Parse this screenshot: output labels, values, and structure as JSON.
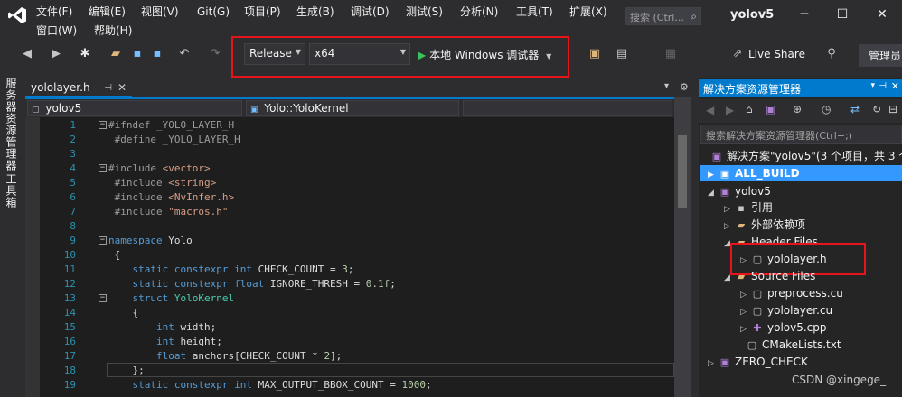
{
  "menu": {
    "row1": [
      "文件(F)",
      "编辑(E)",
      "视图(V)",
      "Git(G)",
      "项目(P)",
      "生成(B)",
      "调试(D)",
      "测试(S)",
      "分析(N)",
      "工具(T)",
      "扩展(X)"
    ],
    "row2": [
      "窗口(W)",
      "帮助(H)"
    ],
    "search_placeholder": "搜索 (Ctrl...",
    "window_title": "yolov5"
  },
  "toolbar": {
    "config": "Release",
    "platform": "x64",
    "debugger": "本地 Windows 调试器",
    "live_share": "Live Share",
    "admin": "管理员"
  },
  "left_strip": {
    "server_explorer": "服务器资源管理器",
    "toolbox": "工具箱"
  },
  "editor": {
    "tab_name": "yololayer.h",
    "nav_project": "yolov5",
    "nav_scope": "Yolo::YoloKernel",
    "line_numbers": [
      "1",
      "2",
      "3",
      "4",
      "5",
      "6",
      "7",
      "8",
      "9",
      "10",
      "11",
      "12",
      "13",
      "14",
      "15",
      "16",
      "17",
      "18",
      "19"
    ],
    "lines": {
      "l1": "#ifndef _YOLO_LAYER_H",
      "l2": "#define _YOLO_LAYER_H",
      "l4a": "#include ",
      "l4b": "<vector>",
      "l5a": "#include ",
      "l5b": "<string>",
      "l6a": "#include ",
      "l6b": "<NvInfer.h>",
      "l7a": "#include ",
      "l7b": "\"macros.h\"",
      "l9a": "namespace",
      "l9b": " Yolo",
      "l10": "{",
      "l11a": "static constexpr int",
      "l11b": " CHECK_COUNT = ",
      "l11c": "3",
      "l11d": ";",
      "l12a": "static constexpr float",
      "l12b": " IGNORE_THRESH = ",
      "l12c": "0.1f",
      "l12d": ";",
      "l13a": "struct",
      "l13b": " YoloKernel",
      "l14": "{",
      "l15a": "int",
      "l15b": " width;",
      "l16a": "int",
      "l16b": " height;",
      "l17a": "float",
      "l17b": " anchors[CHECK_COUNT * ",
      "l17c": "2",
      "l17d": "];",
      "l18": "};",
      "l19a": "static constexpr int",
      "l19b": " MAX_OUTPUT_BBOX_COUNT = ",
      "l19c": "1000",
      "l19d": ";"
    }
  },
  "solution_explorer": {
    "title": "解决方案资源管理器",
    "search_placeholder": "搜索解决方案资源管理器(Ctrl+;)",
    "solution": "解决方案\"yolov5\"(3 个项目，共 3 个",
    "items": {
      "all_build": "ALL_BUILD",
      "yolov5": "yolov5",
      "refs": "引用",
      "ext_deps": "外部依赖项",
      "header_files": "Header Files",
      "yololayer_h": "yololayer.h",
      "source_files": "Source Files",
      "preprocess_cu": "preprocess.cu",
      "yololayer_cu": "yololayer.cu",
      "yolov5_cpp": "yolov5.cpp",
      "cmakelists": "CMakeLists.txt",
      "zero_check": "ZERO_CHECK"
    }
  },
  "watermark": "CSDN @xingege_",
  "colors": {
    "accent": "#007acc",
    "highlight_box": "#e8141c",
    "selection": "#3399ff"
  }
}
